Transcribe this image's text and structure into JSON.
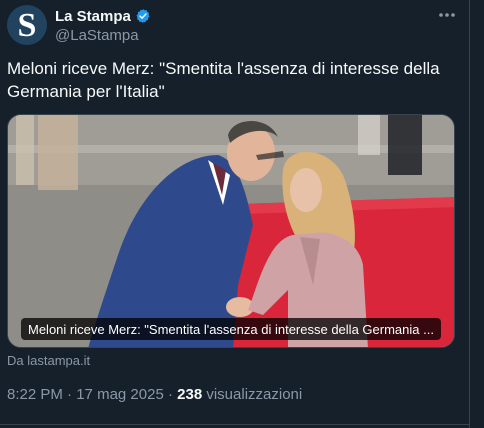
{
  "author": {
    "name": "La Stampa",
    "handle": "@LaStampa",
    "avatar_letter": "S",
    "verified_color": "#1d9bf0",
    "avatar_color": "#21435f"
  },
  "more_icon": "more-icon",
  "tweet": {
    "text": "Meloni riceve Merz: \"Smentita l'assenza di interesse della Germania per l'Italia\""
  },
  "media": {
    "caption": "Meloni riceve Merz: \"Smentita l'assenza di interesse della Germania ...",
    "source": "Da lastampa.it"
  },
  "meta": {
    "time": "8:22 PM",
    "separator": " · ",
    "date": "17 mag 2025",
    "views_count": "238",
    "views_label": " visualizzazioni"
  },
  "colors": {
    "background": "#15202b",
    "primary_text": "#f7f9f9",
    "secondary_text": "#8b98a5",
    "border": "#38444d"
  }
}
